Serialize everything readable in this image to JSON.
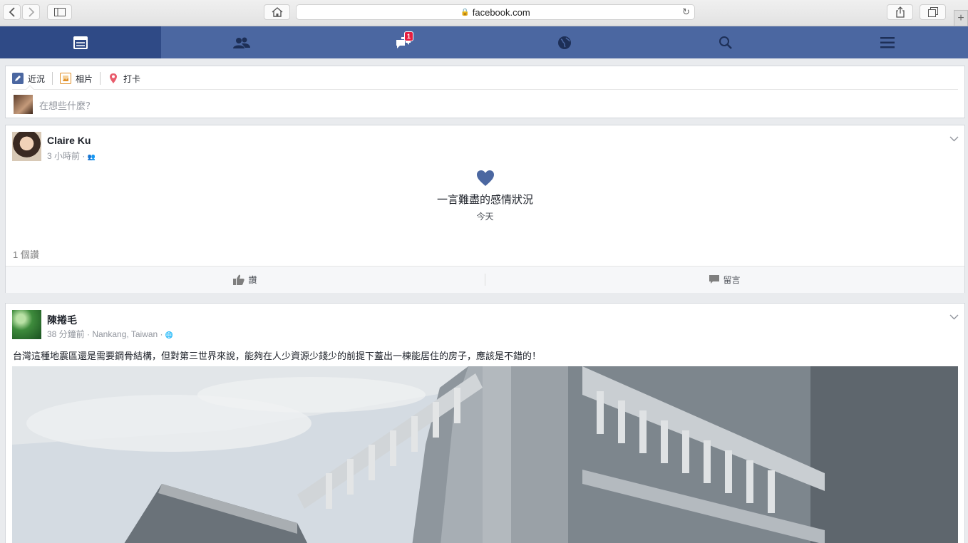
{
  "browser": {
    "url": "facebook.com"
  },
  "fb_nav": {
    "items": [
      {
        "name": "news-feed",
        "icon": "news-feed-icon"
      },
      {
        "name": "friends",
        "icon": "friends-icon"
      },
      {
        "name": "messages",
        "icon": "messages-icon",
        "badge": "1"
      },
      {
        "name": "notifications",
        "icon": "globe-icon"
      },
      {
        "name": "search",
        "icon": "search-icon"
      },
      {
        "name": "menu",
        "icon": "menu-icon"
      }
    ],
    "color": "#4b67a1",
    "active_color": "#2f4a86"
  },
  "composer": {
    "tabs": [
      "近況",
      "相片",
      "打卡"
    ],
    "placeholder": "在想些什麼？"
  },
  "posts": [
    {
      "author": "Claire Ku",
      "meta": "3 小時前 ·",
      "life_event_title": "一言難盡的感情狀況",
      "life_event_date": "今天",
      "like_count": "1 個讚",
      "like_label": "讚",
      "comment_label": "留言"
    },
    {
      "author": "陳捲毛",
      "meta": "38 分鐘前 · Nankang, Taiwan ·",
      "text": "台灣這種地震區還是需要鋼骨結構，但對第三世界來說，能夠在人少資源少錢少的前提下蓋出一棟能居住的房子，應該是不錯的！"
    }
  ]
}
